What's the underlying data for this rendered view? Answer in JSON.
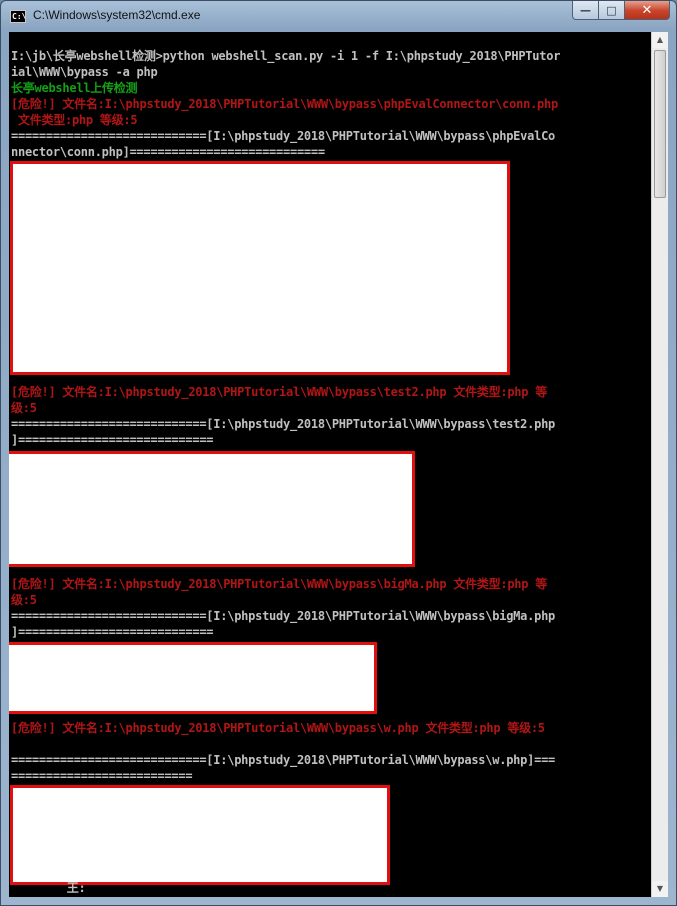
{
  "window": {
    "title": "C:\\Windows\\system32\\cmd.exe",
    "icon_text": "C:\\",
    "controls": {
      "minimize": "—",
      "maximize": "□",
      "close": "✕"
    }
  },
  "console": {
    "lines": [
      {
        "text": "I:\\jb\\长亭webshell检测>python webshell_scan.py -i 1 -f I:\\phpstudy_2018\\PHPTutor",
        "color": "#c0c0c0"
      },
      {
        "text": "ial\\WWW\\bypass -a php",
        "color": "#c0c0c0"
      },
      {
        "text": "长亭webshell上传检测",
        "color": "#15a015"
      },
      {
        "text": "[危险!] 文件名:I:\\phpstudy_2018\\PHPTutorial\\WWW\\bypass\\phpEvalConnector\\conn.php",
        "color": "#b01616"
      },
      {
        "text": " 文件类型:php 等级:5",
        "color": "#b01616"
      },
      {
        "text": "============================[I:\\phpstudy_2018\\PHPTutorial\\WWW\\bypass\\phpEvalCo",
        "color": "#c0c0c0"
      },
      {
        "text": "nnector\\conn.php]============================",
        "color": "#c0c0c0"
      },
      {
        "text": "[危险!] 文件名:I:\\phpstudy_2018\\PHPTutorial\\WWW\\bypass\\test2.php 文件类型:php 等",
        "color": "#b01616"
      },
      {
        "text": "级:5",
        "color": "#b01616"
      },
      {
        "text": "============================[I:\\phpstudy_2018\\PHPTutorial\\WWW\\bypass\\test2.php",
        "color": "#c0c0c0"
      },
      {
        "text": "]============================",
        "color": "#c0c0c0"
      },
      {
        "text": "[危险!] 文件名:I:\\phpstudy_2018\\PHPTutorial\\WWW\\bypass\\bigMa.php 文件类型:php 等",
        "color": "#b01616"
      },
      {
        "text": "级:5",
        "color": "#b01616"
      },
      {
        "text": "============================[I:\\phpstudy_2018\\PHPTutorial\\WWW\\bypass\\bigMa.php",
        "color": "#c0c0c0"
      },
      {
        "text": "]============================",
        "color": "#c0c0c0"
      },
      {
        "text": "[危险!] 文件名:I:\\phpstudy_2018\\PHPTutorial\\WWW\\bypass\\w.php 文件类型:php 等级:5",
        "color": "#b01616"
      },
      {
        "text": "============================[I:\\phpstudy_2018\\PHPTutorial\\WWW\\bypass\\w.php]===",
        "color": "#c0c0c0"
      },
      {
        "text": "==========================",
        "color": "#c0c0c0"
      },
      {
        "text": "        王:",
        "color": "#c0c0c0"
      }
    ]
  },
  "scrollbar": {
    "up_arrow": "▲",
    "down_arrow": "▼"
  },
  "redaction_color": "#e01010"
}
